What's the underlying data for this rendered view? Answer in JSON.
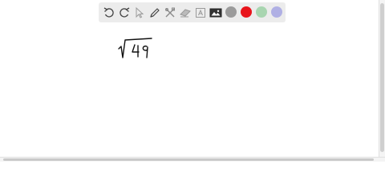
{
  "toolbar": {
    "tools": [
      {
        "name": "undo-icon"
      },
      {
        "name": "redo-icon"
      },
      {
        "name": "select-pointer-icon"
      },
      {
        "name": "pen-icon"
      },
      {
        "name": "tools-icon"
      },
      {
        "name": "eraser-icon"
      },
      {
        "name": "text-icon"
      },
      {
        "name": "image-icon"
      }
    ],
    "colors": [
      {
        "name": "color-gray",
        "hex": "#9b9b9b"
      },
      {
        "name": "color-red",
        "hex": "#e8141b"
      },
      {
        "name": "color-green",
        "hex": "#a8d5b0"
      },
      {
        "name": "color-lavender",
        "hex": "#b0b0e4"
      }
    ]
  },
  "canvas": {
    "ink_color": "#111111",
    "handwriting": "√49"
  }
}
